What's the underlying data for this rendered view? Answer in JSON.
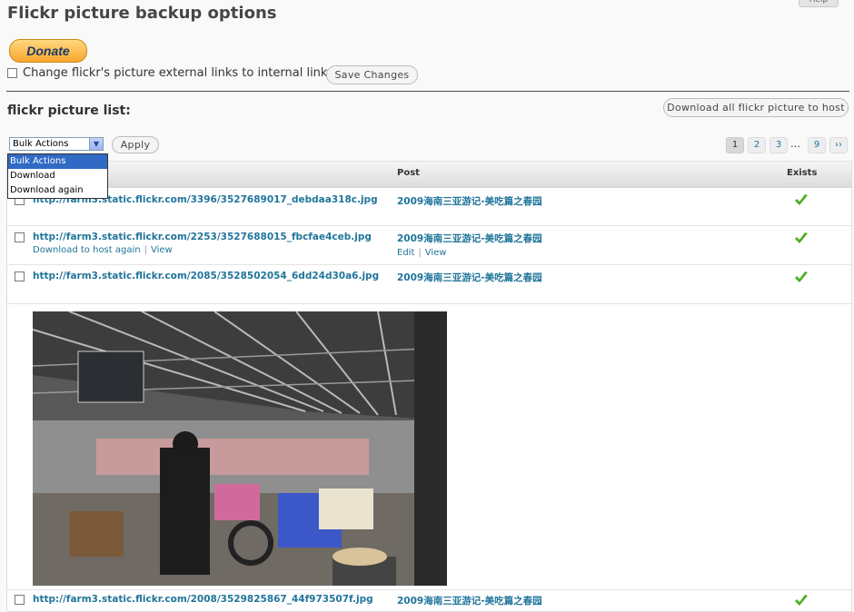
{
  "help_label": "Help",
  "page_title": "Flickr picture backup options",
  "donate_label": "Donate",
  "external_links_label": "Change flickr's picture external links to internal links",
  "save_label": "Save Changes",
  "list_title": "flickr picture list:",
  "download_all_label": "Download all flickr picture to host",
  "bulk": {
    "selected": "Bulk Actions",
    "options": [
      "Bulk Actions",
      "Download",
      "Download again"
    ]
  },
  "apply_label": "Apply",
  "pagination": {
    "pages": [
      "1",
      "2",
      "3",
      "9"
    ],
    "current": "1",
    "ellipsis": "…",
    "next": "››"
  },
  "table": {
    "columns": [
      "Post",
      "Exists"
    ],
    "rows": [
      {
        "url": "http://farm3.static.flickr.com/3396/3527689017_debdaa318c.jpg",
        "post": "2009海南三亚游记-美吃篇之春园",
        "exists": true
      },
      {
        "url": "http://farm3.static.flickr.com/2253/3527688015_fbcfae4ceb.jpg",
        "url_actions": [
          "Download to host again",
          "View"
        ],
        "post": "2009海南三亚游记-美吃篇之春园",
        "post_actions": [
          "Edit",
          "View"
        ],
        "exists": true
      },
      {
        "url": "http://farm3.static.flickr.com/2085/3528502054_6dd24d30a6.jpg",
        "post": "2009海南三亚游记-美吃篇之春园",
        "exists": true
      },
      {
        "url": "http://farm3.static.flickr.com/2008/3529825867_44f973507f.jpg",
        "post": "2009海南三亚游记-美吃篇之春园",
        "exists": true
      }
    ]
  },
  "colors": {
    "link": "#21759b",
    "check": "#4caf25",
    "dropdown_selected": "#316ac5"
  }
}
